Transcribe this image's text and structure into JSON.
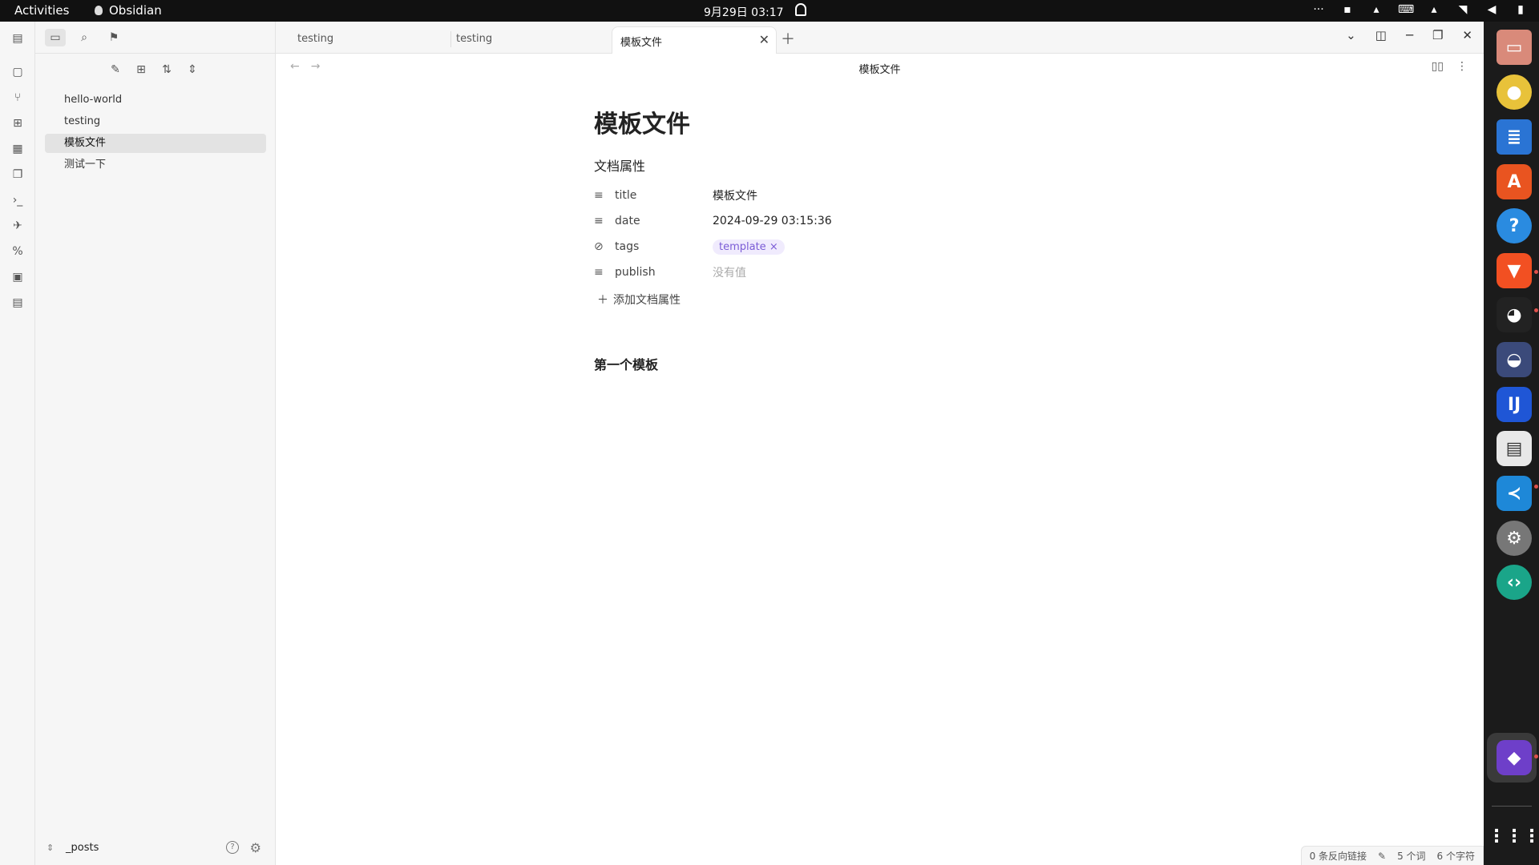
{
  "topbar": {
    "activities": "Activities",
    "app_name": "Obsidian",
    "clock": "9月29日  03:17",
    "tray_more": "···"
  },
  "ribbon_icons": [
    "open-quick-switcher-icon",
    "graph-view-icon",
    "canvas-icon",
    "daily-note-icon",
    "templates-icon",
    "command-palette-icon",
    "publish-icon",
    "markdown-format-icon",
    "terminal-icon",
    "file-code-icon"
  ],
  "sidebar": {
    "files": [
      "hello-world",
      "testing",
      "模板文件",
      "测试一下"
    ],
    "selected_index": 2,
    "vault_name": "_posts"
  },
  "tabs": [
    {
      "label": "testing",
      "active": false
    },
    {
      "label": "testing",
      "active": false
    },
    {
      "label": "模板文件",
      "active": true
    }
  ],
  "view": {
    "title": "模板文件"
  },
  "document": {
    "title": "模板文件",
    "properties_heading": "文档属性",
    "properties": [
      {
        "key": "title",
        "value": "模板文件",
        "icon": "text-lines-icon"
      },
      {
        "key": "date",
        "value": "2024-09-29 03:15:36",
        "icon": "text-lines-icon"
      },
      {
        "key": "tags",
        "tag": "template",
        "icon": "tags-icon"
      },
      {
        "key": "publish",
        "empty": "没有值",
        "icon": "text-lines-icon"
      }
    ],
    "add_property": "添加文档属性",
    "heading": "第一个模板"
  },
  "status": {
    "backlinks": "0 条反向链接",
    "words": "5 个词",
    "chars": "6 个字符"
  },
  "dock_apps": [
    "files-icon",
    "rhythmbox-icon",
    "writer-icon",
    "app-center-icon",
    "help-icon",
    "brave-icon",
    "qq-icon",
    "cat-app-icon",
    "intellij-icon",
    "document-viewer-icon",
    "vscode-icon",
    "settings-icon",
    "remote-desktop-icon",
    "obsidian-icon",
    "show-apps-icon"
  ]
}
